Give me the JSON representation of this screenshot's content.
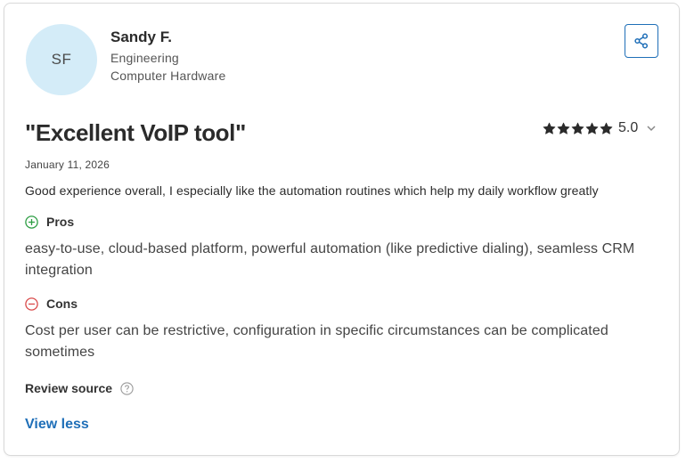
{
  "reviewer": {
    "initials": "SF",
    "name": "Sandy F.",
    "role": "Engineering",
    "industry": "Computer Hardware"
  },
  "review": {
    "title": "\"Excellent VoIP tool\"",
    "rating": "5.0",
    "stars_filled": 5,
    "stars_total": 5,
    "date": "January 11, 2026",
    "summary": "Good experience overall, I especially like the automation routines which help my daily workflow greatly",
    "pros_label": "Pros",
    "pros_text": "easy-to-use, cloud-based platform, powerful automation (like predictive dialing), seamless CRM integration",
    "cons_label": "Cons",
    "cons_text": "Cost per user can be restrictive, configuration in specific circumstances can be complicated sometimes",
    "source_label": "Review source",
    "view_less_label": "View less"
  },
  "icons": {
    "share": "share-icon",
    "star": "star-icon",
    "chevron": "chevron-down-icon",
    "pros": "plus-circle-icon",
    "cons": "minus-circle-icon",
    "help": "question-circle-icon"
  },
  "colors": {
    "accent": "#1f6fb8",
    "avatar_bg": "#d4ecf8",
    "pros": "#2e9e44",
    "cons": "#d94a4a",
    "star": "#2b2b2b"
  }
}
